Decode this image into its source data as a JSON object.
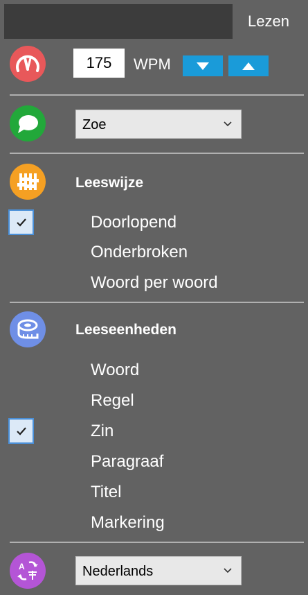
{
  "tab": {
    "label": "Lezen"
  },
  "speed": {
    "value": "175",
    "unit": "WPM"
  },
  "voice": {
    "selected": "Zoe"
  },
  "reading_mode": {
    "header": "Leeswijze",
    "options": [
      "Doorlopend",
      "Onderbroken",
      "Woord per woord"
    ],
    "checked": "Doorlopend"
  },
  "reading_units": {
    "header": "Leeseenheden",
    "options": [
      "Woord",
      "Regel",
      "Zin",
      "Paragraaf",
      "Titel",
      "Markering"
    ],
    "checked": "Zin"
  },
  "language": {
    "selected": "Nederlands"
  },
  "colors": {
    "speed_icon": "#e8585a",
    "voice_icon": "#22a83a",
    "mode_icon": "#f5a023",
    "units_icon": "#6f8fe6",
    "language_icon": "#b455d6",
    "accent": "#1a9bd9"
  },
  "icons": [
    "speedometer-icon",
    "speech-bubble-icon",
    "equalizer-icon",
    "tape-measure-icon",
    "translate-icon"
  ]
}
